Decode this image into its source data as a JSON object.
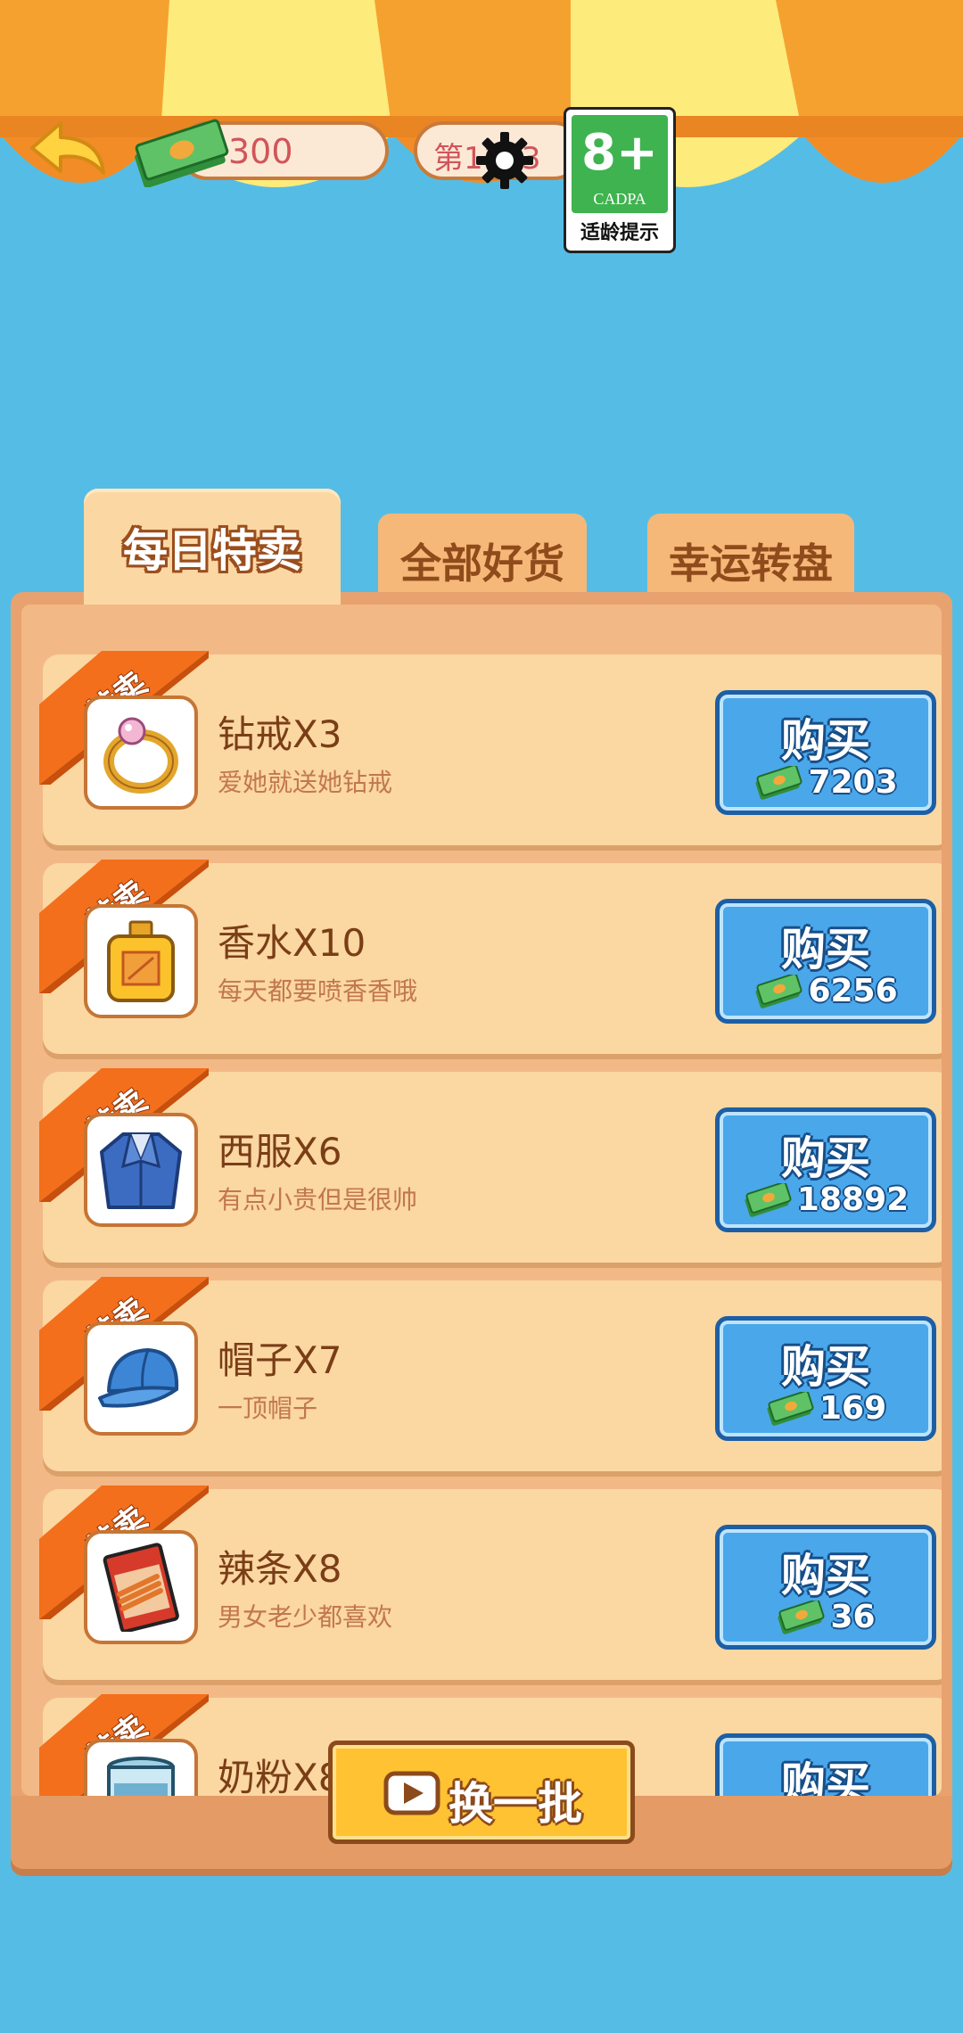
{
  "header": {
    "money": "300",
    "level": "第1103",
    "age_rating": {
      "number": "8+",
      "org": "CADPA",
      "tip": "适龄提示"
    }
  },
  "tabs": [
    {
      "label": "每日特卖",
      "active": true
    },
    {
      "label": "全部好货",
      "active": false
    },
    {
      "label": "幸运转盘",
      "active": false
    }
  ],
  "ribbon_label": "特卖",
  "buy_label": "购买",
  "items": [
    {
      "name": "钻戒X3",
      "desc": "爱她就送她钻戒",
      "price": "7203",
      "icon": "ring-icon"
    },
    {
      "name": "香水X10",
      "desc": "每天都要喷香香哦",
      "price": "6256",
      "icon": "perfume-icon"
    },
    {
      "name": "西服X6",
      "desc": "有点小贵但是很帅",
      "price": "18892",
      "icon": "suit-icon"
    },
    {
      "name": "帽子X7",
      "desc": "一顶帽子",
      "price": "169",
      "icon": "cap-icon"
    },
    {
      "name": "辣条X8",
      "desc": "男女老少都喜欢",
      "price": "36",
      "icon": "spicy-strip-icon"
    },
    {
      "name": "奶粉X8",
      "desc": "",
      "price": "",
      "icon": "milk-powder-icon"
    }
  ],
  "refresh_label": "换一批",
  "colors": {
    "background": "#55bde5",
    "card": "#fbd7a2",
    "buy_button": "#4aa7ea",
    "ribbon": "#f36f1c",
    "refresh_button": "#ffc233"
  }
}
